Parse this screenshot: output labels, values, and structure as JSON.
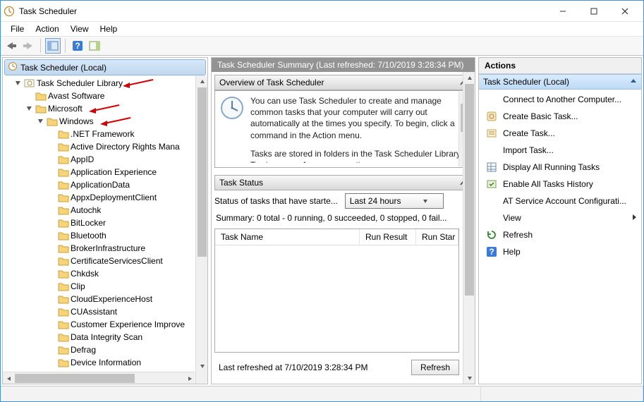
{
  "window": {
    "title": "Task Scheduler"
  },
  "menus": [
    "File",
    "Action",
    "View",
    "Help"
  ],
  "tree": {
    "root": "Task Scheduler (Local)",
    "library": "Task Scheduler Library",
    "avast": "Avast Software",
    "microsoft": "Microsoft",
    "windows": "Windows",
    "items": [
      ".NET Framework",
      "Active Directory Rights Mana",
      "AppID",
      "Application Experience",
      "ApplicationData",
      "AppxDeploymentClient",
      "Autochk",
      "BitLocker",
      "Bluetooth",
      "BrokerInfrastructure",
      "CertificateServicesClient",
      "Chkdsk",
      "Clip",
      "CloudExperienceHost",
      "CUAssistant",
      "Customer Experience Improve",
      "Data Integrity Scan",
      "Defrag",
      "Device Information"
    ]
  },
  "summary": {
    "header": "Task Scheduler Summary (Last refreshed: 7/10/2019 3:28:34 PM)",
    "overview_title": "Overview of Task Scheduler",
    "overview_p1": "You can use Task Scheduler to create and manage common tasks that your computer will carry out automatically at the times you specify. To begin, click a command in the Action menu.",
    "overview_p2": "Tasks are stored in folders in the Task Scheduler Library. To view or perform an operation on an",
    "status_title": "Task Status",
    "status_label": "Status of tasks that have starte...",
    "status_period": "Last 24 hours",
    "status_summary": "Summary: 0 total - 0 running, 0 succeeded, 0 stopped, 0 fail...",
    "cols": [
      "Task Name",
      "Run Result",
      "Run Star"
    ],
    "footer": "Last refreshed at 7/10/2019 3:28:34 PM",
    "refresh": "Refresh"
  },
  "actions": {
    "title": "Actions",
    "section": "Task Scheduler (Local)",
    "items": [
      {
        "icon": "blank",
        "label": "Connect to Another Computer..."
      },
      {
        "icon": "basic",
        "label": "Create Basic Task..."
      },
      {
        "icon": "task",
        "label": "Create Task..."
      },
      {
        "icon": "blank",
        "label": "Import Task..."
      },
      {
        "icon": "grid",
        "label": "Display All Running Tasks"
      },
      {
        "icon": "hist",
        "label": "Enable All Tasks History"
      },
      {
        "icon": "blank",
        "label": "AT Service Account Configurati..."
      },
      {
        "icon": "arrow",
        "label": "View"
      },
      {
        "icon": "refresh",
        "label": "Refresh"
      },
      {
        "icon": "help",
        "label": "Help"
      }
    ]
  }
}
